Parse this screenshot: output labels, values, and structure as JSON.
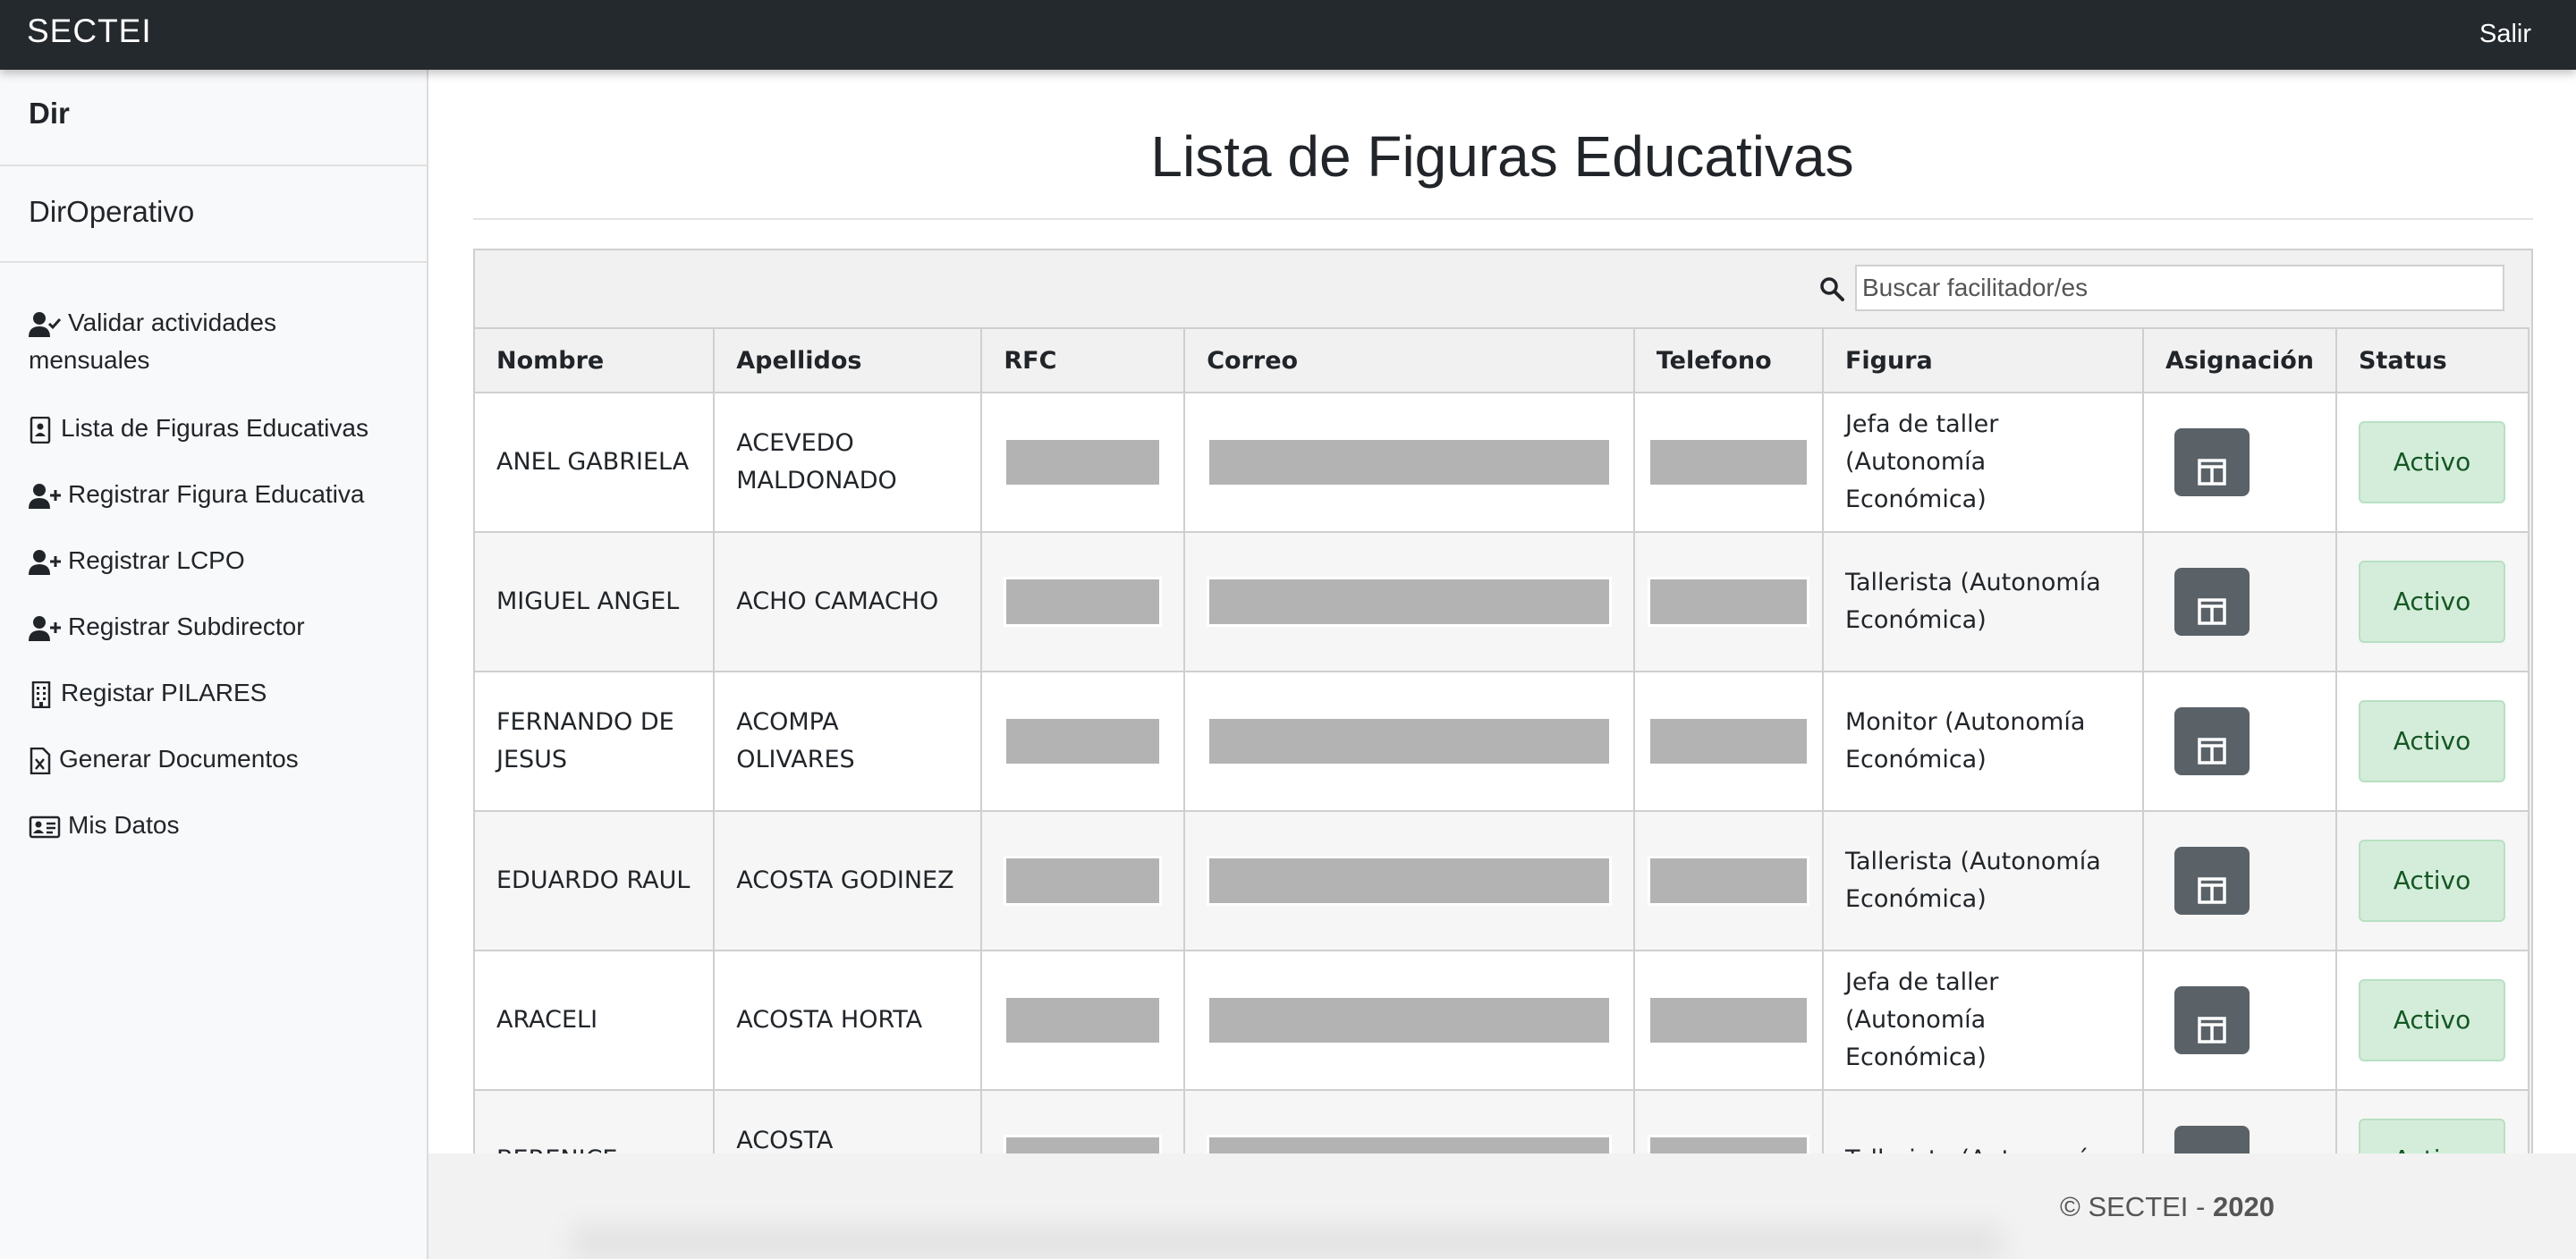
{
  "navbar": {
    "brand": "SECTEI",
    "logout": "Salir"
  },
  "sidebar": {
    "heading1": "Dir",
    "heading2": "DirOperativo",
    "items": [
      {
        "label": "Validar actividades mensuales",
        "icon": "user-check-icon"
      },
      {
        "label": "Lista de Figuras Educativas",
        "icon": "id-list-icon"
      },
      {
        "label": "Registrar Figura Educativa",
        "icon": "user-plus-icon"
      },
      {
        "label": "Registrar LCPO",
        "icon": "user-plus-icon"
      },
      {
        "label": "Registrar Subdirector",
        "icon": "user-plus-icon"
      },
      {
        "label": "Registar PILARES",
        "icon": "building-icon"
      },
      {
        "label": "Generar Documentos",
        "icon": "file-excel-icon"
      },
      {
        "label": "Mis Datos",
        "icon": "id-card-icon"
      }
    ]
  },
  "main": {
    "title": "Lista de Figuras Educativas",
    "search": {
      "placeholder": "Buscar facilitador/es"
    },
    "columns": [
      "Nombre",
      "Apellidos",
      "RFC",
      "Correo",
      "Telefono",
      "Figura",
      "Asignación",
      "Status"
    ],
    "rows": [
      {
        "nombre": "ANEL GABRIELA",
        "apellidos": "ACEVEDO MALDONADO",
        "figura": "Jefa de taller (Autonomía Económica)",
        "status": "Activo"
      },
      {
        "nombre": "MIGUEL ANGEL",
        "apellidos": "ACHO CAMACHO",
        "figura": "Tallerista (Autonomía Económica)",
        "status": "Activo"
      },
      {
        "nombre": "FERNANDO DE JESUS",
        "apellidos": "ACOMPA OLIVARES",
        "figura": "Monitor (Autonomía Económica)",
        "status": "Activo"
      },
      {
        "nombre": "EDUARDO RAUL",
        "apellidos": "ACOSTA GODINEZ",
        "figura": "Tallerista (Autonomía Económica)",
        "status": "Activo"
      },
      {
        "nombre": "ARACELI",
        "apellidos": "ACOSTA HORTA",
        "figura": "Jefa de taller (Autonomía Económica)",
        "status": "Activo"
      },
      {
        "nombre": "BERENICE",
        "apellidos": "ACOSTA QUEZADA",
        "figura": "Tallerista (Autonomía",
        "status": "Activo"
      }
    ]
  },
  "footer": {
    "copyright": "© SECTEI - ",
    "year": "2020"
  },
  "colors": {
    "navbar": "#24292e",
    "assign_button": "#5a6268",
    "status_bg": "#d4edda",
    "status_text": "#155724"
  }
}
